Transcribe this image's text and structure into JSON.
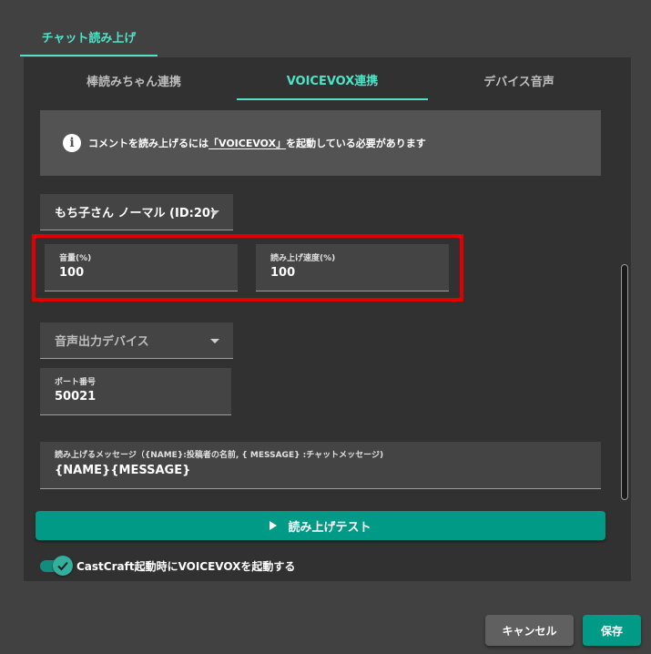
{
  "top_tab": {
    "label": "チャット読み上げ"
  },
  "subtabs": [
    {
      "label": "棒読みちゃん連携"
    },
    {
      "label": "VOICEVOX連携"
    },
    {
      "label": "デバイス音声"
    }
  ],
  "info": {
    "icon": "info-icon",
    "text_before": "コメントを読み上げるには",
    "link_text": "「VOICEVOX」",
    "text_after": "を起動している必要があります"
  },
  "voice_select": {
    "value": "もち子さん ノーマル (ID:20)"
  },
  "volume": {
    "label": "音量(%)",
    "value": "100"
  },
  "speed": {
    "label": "読み上げ速度(%)",
    "value": "100"
  },
  "output_device": {
    "placeholder": "音声出力デバイス"
  },
  "port": {
    "label": "ポート番号",
    "value": "50021"
  },
  "message_template": {
    "label": "読み上げるメッセージ（{NAME}:投稿者の名前, { MESSAGE} :チャットメッセージ)",
    "value": "{NAME}{MESSAGE}"
  },
  "test_button": {
    "label": "読み上げテスト",
    "icon": "play-icon"
  },
  "autostart_toggle": {
    "label": "CastCraft起動時にVOICEVOXを起動する",
    "checked": true
  },
  "footer": {
    "cancel_label": "キャンセル",
    "save_label": "保存"
  },
  "colors": {
    "accent": "#4ee3c6",
    "primary_button": "#009a87",
    "highlight": "#e00000"
  }
}
